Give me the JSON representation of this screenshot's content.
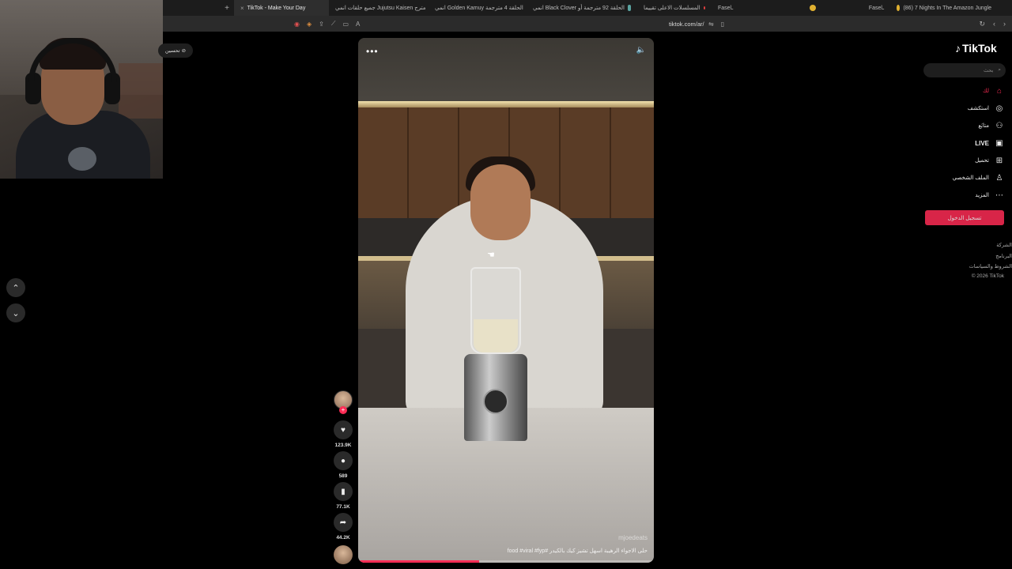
{
  "browser": {
    "new_tab_glyph": "+",
    "tabs": [
      {
        "label": "TikTok - Make Your Day",
        "active": true
      },
      {
        "label": "جميع حلقات انمي Jujutsu Kaisen مترج",
        "active": false
      },
      {
        "label": "انمي Golden Kamuy الحلقة 4 مترجمة",
        "active": false
      },
      {
        "label": "انمي Black Clover الحلقة 92 مترجمة أو",
        "active": false
      },
      {
        "label": "المسلسلات الاعلى تقييما",
        "active": false
      },
      {
        "label": "Faselـ",
        "active": false
      },
      {
        "label": "Faselـ",
        "active": false
      },
      {
        "label": "(86) 7 Nights In The Amazon Jungle",
        "active": false
      }
    ],
    "url": "tiktok.com/ar/",
    "tab_close": "×"
  },
  "overlay": {
    "label": "تحسين"
  },
  "video": {
    "more_glyph": "•••",
    "mute_glyph": "🔈",
    "watermark": "mjoedeats",
    "caption": "حلى الاجواء الرهيبة اسهل تشيز كيك بالكيدر #food #viral #fyp",
    "progress": 0.41
  },
  "rail": {
    "likes": "123.9K",
    "comments": "589",
    "saves": "77.1K",
    "shares": "44.2K",
    "plus_glyph": "+"
  },
  "sidebar": {
    "logo": "TikTok",
    "search_placeholder": "بحث",
    "items": [
      {
        "label": "لك",
        "icon": "home-icon"
      },
      {
        "label": "استكشف",
        "icon": "compass-icon"
      },
      {
        "label": "متابَع",
        "icon": "following-icon"
      },
      {
        "label": "LIVE",
        "icon": "live-icon"
      },
      {
        "label": "تحميل",
        "icon": "upload-icon"
      },
      {
        "label": "الملف الشخصي",
        "icon": "profile-icon"
      },
      {
        "label": "المزيد",
        "icon": "more-icon"
      }
    ],
    "login_label": "تسجيل الدخول",
    "footer": [
      "الشركة",
      "البرنامج",
      "الشروط والسياسات",
      "© 2026 TikTok"
    ]
  },
  "colors": {
    "accent": "#fe2c55",
    "background": "#000000"
  }
}
